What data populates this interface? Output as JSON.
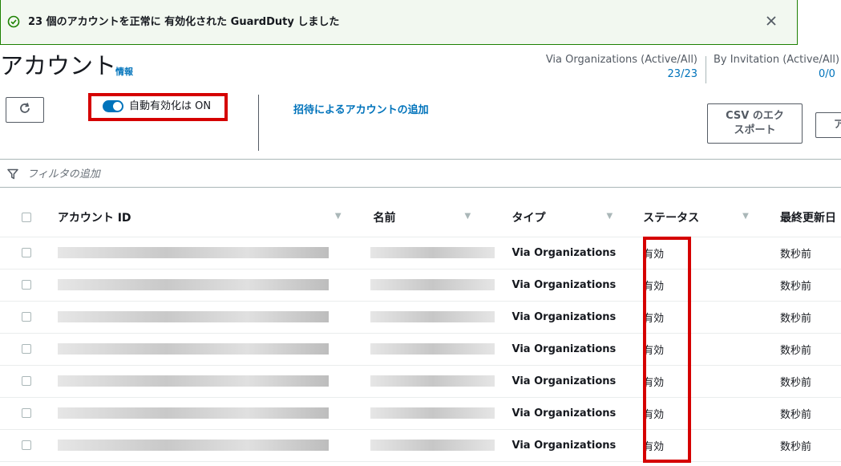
{
  "flash": {
    "message": "23 個のアカウントを正常に 有効化された GuardDuty しました",
    "icon": "check-circle-icon",
    "close_icon": "close-icon",
    "accent": "#1d8102"
  },
  "header": {
    "title": "アカウント",
    "info_link": "情報",
    "stat_orgs_label": "Via Organizations (Active/All)",
    "stat_orgs_value": "23/23",
    "stat_invite_label": "By Invitation (Active/All)",
    "stat_invite_value": "0/0"
  },
  "toolbar": {
    "refresh_icon": "refresh-icon",
    "auto_enable_label": "自動有効化は ON",
    "add_by_invitation": "招待によるアカウントの追加",
    "csv_export_label_line1": "CSV のエク",
    "csv_export_label_line2": "スポート",
    "more_button_label": "ア"
  },
  "filter": {
    "placeholder": "フィルタの追加",
    "icon": "filter-icon"
  },
  "table": {
    "columns": [
      "アカウント ID",
      "名前",
      "タイプ",
      "ステータス",
      "最終更新日"
    ],
    "rows": [
      {
        "type": "Via Organizations",
        "status": "有効",
        "updated": "数秒前"
      },
      {
        "type": "Via Organizations",
        "status": "有効",
        "updated": "数秒前"
      },
      {
        "type": "Via Organizations",
        "status": "有効",
        "updated": "数秒前"
      },
      {
        "type": "Via Organizations",
        "status": "有効",
        "updated": "数秒前"
      },
      {
        "type": "Via Organizations",
        "status": "有効",
        "updated": "数秒前"
      },
      {
        "type": "Via Organizations",
        "status": "有効",
        "updated": "数秒前"
      },
      {
        "type": "Via Organizations",
        "status": "有効",
        "updated": "数秒前"
      }
    ]
  },
  "colors": {
    "link": "#0073bb",
    "highlight_box": "#d50000"
  }
}
